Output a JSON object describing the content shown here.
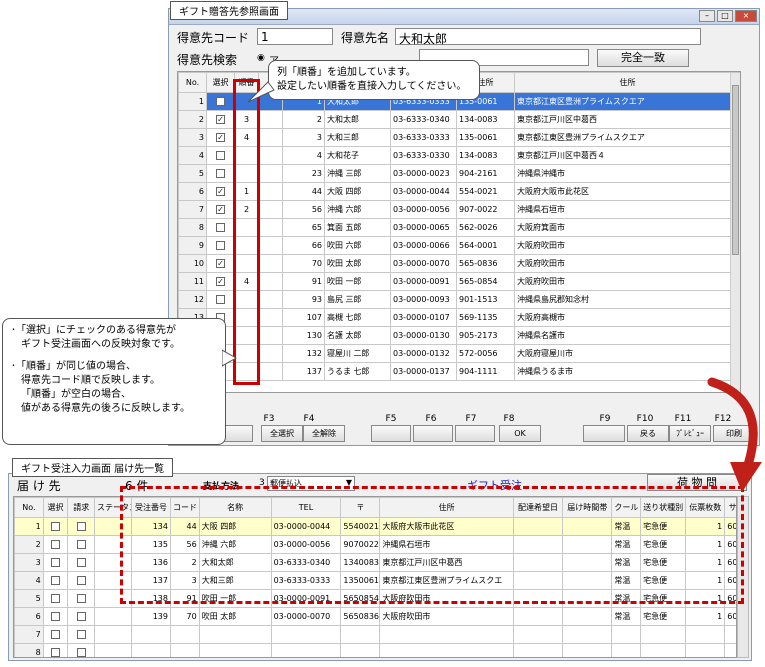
{
  "win1": {
    "tab_label": "ギフト贈答先参照画面",
    "code_label": "得意先コード",
    "code_value": "1",
    "name_label": "得意先名",
    "name_value": "大和太郎",
    "search_label": "得意先検索",
    "search_radio_text": "ア",
    "exact_button": "完全一致",
    "columns": [
      "No.",
      "選択",
      "順番",
      "",
      "",
      "",
      "",
      "住所"
    ],
    "rows": [
      {
        "no": "1",
        "checked": false,
        "order": "",
        "code": "1",
        "name": "大和太郎",
        "tel": "03-6333-0333",
        "zip": "135-0061",
        "address": "東京都江東区豊洲プライムスクエア",
        "selected": true
      },
      {
        "no": "2",
        "checked": true,
        "order": "3",
        "code": "2",
        "name": "大和太郎",
        "tel": "03-6333-0340",
        "zip": "134-0083",
        "address": "東京都江戸川区中葛西"
      },
      {
        "no": "3",
        "checked": true,
        "order": "4",
        "code": "3",
        "name": "大和三郎",
        "tel": "03-6333-0333",
        "zip": "135-0061",
        "address": "東京都江東区豊洲プライムスクエア"
      },
      {
        "no": "4",
        "checked": false,
        "order": "",
        "code": "4",
        "name": "大和花子",
        "tel": "03-6333-0330",
        "zip": "134-0083",
        "address": "東京都江戸川区中葛西４"
      },
      {
        "no": "5",
        "checked": false,
        "order": "",
        "code": "23",
        "name": "沖縄 三郎",
        "tel": "03-0000-0023",
        "zip": "904-2161",
        "address": "沖縄県沖縄市"
      },
      {
        "no": "6",
        "checked": true,
        "order": "1",
        "code": "44",
        "name": "大阪 四郎",
        "tel": "03-0000-0044",
        "zip": "554-0021",
        "address": "大阪府大阪市此花区"
      },
      {
        "no": "7",
        "checked": true,
        "order": "2",
        "code": "56",
        "name": "沖縄 六郎",
        "tel": "03-0000-0056",
        "zip": "907-0022",
        "address": "沖縄県石垣市"
      },
      {
        "no": "8",
        "checked": false,
        "order": "",
        "code": "65",
        "name": "箕面 五郎",
        "tel": "03-0000-0065",
        "zip": "562-0026",
        "address": "大阪府箕面市"
      },
      {
        "no": "9",
        "checked": false,
        "order": "",
        "code": "66",
        "name": "吹田 六郎",
        "tel": "03-0000-0066",
        "zip": "564-0001",
        "address": "大阪府吹田市"
      },
      {
        "no": "10",
        "checked": true,
        "order": "",
        "code": "70",
        "name": "吹田 太郎",
        "tel": "03-0000-0070",
        "zip": "565-0836",
        "address": "大阪府吹田市"
      },
      {
        "no": "11",
        "checked": true,
        "order": "4",
        "code": "91",
        "name": "吹田 一郎",
        "tel": "03-0000-0091",
        "zip": "565-0854",
        "address": "大阪府吹田市"
      },
      {
        "no": "12",
        "checked": false,
        "order": "",
        "code": "93",
        "name": "島尻 三郎",
        "tel": "03-0000-0093",
        "zip": "901-1513",
        "address": "沖縄県島尻郡知念村"
      },
      {
        "no": "13",
        "checked": false,
        "order": "",
        "code": "107",
        "name": "高槻 七郎",
        "tel": "03-0000-0107",
        "zip": "569-1135",
        "address": "大阪府高槻市"
      },
      {
        "no": "14",
        "checked": false,
        "order": "",
        "code": "130",
        "name": "名護 太郎",
        "tel": "03-0000-0130",
        "zip": "905-2173",
        "address": "沖縄県名護市"
      },
      {
        "no": "15",
        "checked": false,
        "order": "",
        "code": "132",
        "name": "寝屋川 二郎",
        "tel": "03-0000-0132",
        "zip": "572-0056",
        "address": "大阪府寝屋川市"
      },
      {
        "no": "16",
        "checked": false,
        "order": "",
        "code": "137",
        "name": "うるま 七郎",
        "tel": "03-0000-0137",
        "zip": "904-1111",
        "address": "沖縄県うるま市"
      }
    ],
    "fkeys": [
      {
        "key": "F2",
        "label": ""
      },
      {
        "key": "F3",
        "label": "全選択"
      },
      {
        "key": "F4",
        "label": "全解除"
      },
      {
        "key": "F5",
        "label": ""
      },
      {
        "key": "F6",
        "label": ""
      },
      {
        "key": "F7",
        "label": ""
      },
      {
        "key": "F8",
        "label": "OK"
      },
      {
        "key": "F9",
        "label": ""
      },
      {
        "key": "F10",
        "label": "戻る"
      },
      {
        "key": "F11",
        "label": "ﾌﾟﾚﾋﾞｭｰ"
      },
      {
        "key": "F12",
        "label": "印刷"
      }
    ]
  },
  "callout_top": {
    "line1": "列「順番」を追加しています。",
    "line2": "設定したい順番を直接入力してください。"
  },
  "callout_left": {
    "line1": "･「選択」にチェックのある得意先が",
    "line2": "ギフト受注画面への反映対象です。",
    "line3": "･「順番」が同じ値の場合、",
    "line4": "得意先コード順で反映します。",
    "line5": "「順番」が空白の場合、",
    "line6": "値がある得意先の後ろに反映します。"
  },
  "win2": {
    "tab_label": "ギフト受注入力画面 届け先一覧",
    "dest_label": "届 け 先",
    "count_label": "6 件",
    "payment_label": "支払方法",
    "payment_value": "3",
    "payment_method": "郵便払込",
    "gift_label": "ギフト受注",
    "goods_button": "荷 物 問",
    "columns": [
      "No.",
      "選択",
      "請求",
      "ステータス",
      "受注番号",
      "コード",
      "名称",
      "TEL",
      "〒",
      "住所",
      "配達希望日",
      "届け時間帯",
      "クール",
      "送り状種別",
      "伝票枚数",
      "サイ"
    ],
    "rows": [
      {
        "no": "1",
        "order_no": "134",
        "code": "44",
        "name": "大阪 四郎",
        "tel": "03-0000-0044",
        "zip": "5540021",
        "address": "大阪府大阪市此花区",
        "cool": "常温",
        "slip": "宅急便",
        "sheets": "1",
        "size": "60ｻ",
        "highlight": true
      },
      {
        "no": "2",
        "order_no": "135",
        "code": "56",
        "name": "沖縄 六郎",
        "tel": "03-0000-0056",
        "zip": "9070022",
        "address": "沖縄県石垣市",
        "cool": "常温",
        "slip": "宅急便",
        "sheets": "1",
        "size": "60ｻ"
      },
      {
        "no": "3",
        "order_no": "136",
        "code": "2",
        "name": "大和太郎",
        "tel": "03-6333-0340",
        "zip": "1340083",
        "address": "東京都江戸川区中葛西",
        "cool": "常温",
        "slip": "宅急便",
        "sheets": "1",
        "size": "60ｻ"
      },
      {
        "no": "4",
        "order_no": "137",
        "code": "3",
        "name": "大和三郎",
        "tel": "03-6333-0333",
        "zip": "1350061",
        "address": "東京都江東区豊洲プライムスクエ",
        "cool": "常温",
        "slip": "宅急便",
        "sheets": "1",
        "size": "60ｻ"
      },
      {
        "no": "5",
        "order_no": "138",
        "code": "91",
        "name": "吹田 一郎",
        "tel": "03-0000-0091",
        "zip": "5650854",
        "address": "大阪府吹田市",
        "cool": "常温",
        "slip": "宅急便",
        "sheets": "1",
        "size": "60ｻ"
      },
      {
        "no": "6",
        "order_no": "139",
        "code": "70",
        "name": "吹田 太郎",
        "tel": "03-0000-0070",
        "zip": "5650836",
        "address": "大阪府吹田市",
        "cool": "常温",
        "slip": "宅急便",
        "sheets": "1",
        "size": "60ｻ"
      },
      {
        "no": "7"
      },
      {
        "no": "8"
      },
      {
        "no": "9"
      },
      {
        "no": "10"
      }
    ]
  },
  "colors": {
    "selection": "#3875d7",
    "highlight_border_red": "#cc0000",
    "gift_label_blue": "#1a1acc",
    "arrow_red": "#c0201a"
  }
}
